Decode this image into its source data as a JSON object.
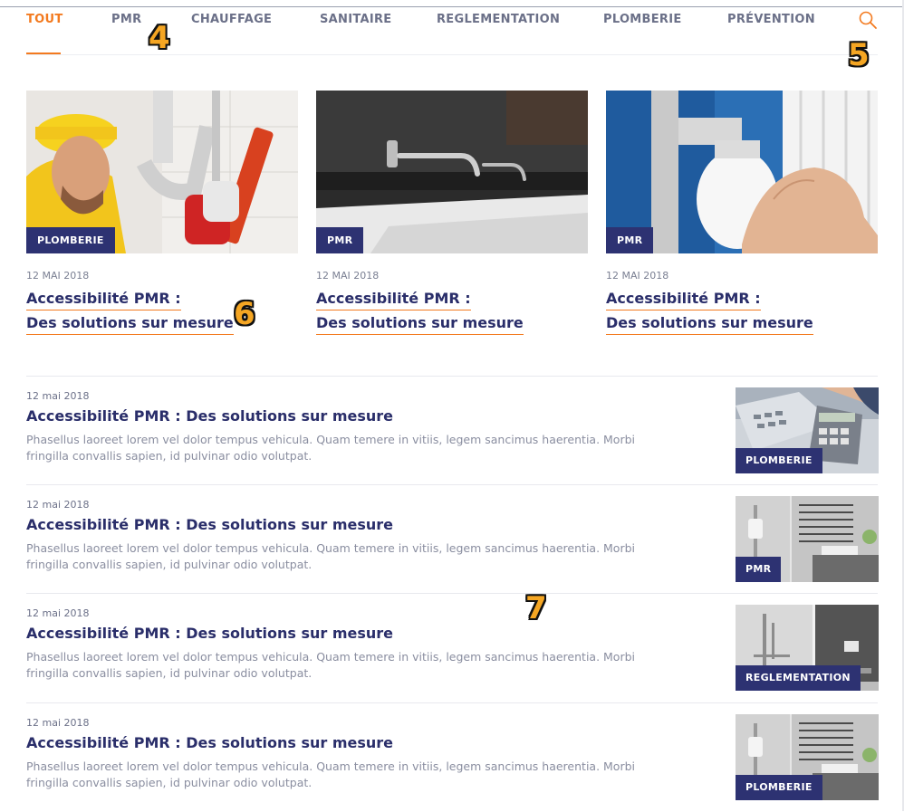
{
  "nav": {
    "items": [
      {
        "label": "TOUT",
        "active": true
      },
      {
        "label": "PMR",
        "active": false
      },
      {
        "label": "CHAUFFAGE",
        "active": false
      },
      {
        "label": "SANITAIRE",
        "active": false
      },
      {
        "label": "REGLEMENTATION",
        "active": false
      },
      {
        "label": "PLOMBERIE",
        "active": false
      },
      {
        "label": "PRÉVENTION",
        "active": false
      }
    ],
    "search_icon": "search-icon",
    "accent": "#f37a1f"
  },
  "markers": [
    "4",
    "5",
    "6",
    "7"
  ],
  "featured": [
    {
      "category": "PLOMBERIE",
      "date": "12 MAI 2018",
      "title_line1": "Accessibilité PMR :",
      "title_line2": "Des solutions sur mesure",
      "image": "plumber-with-wrench"
    },
    {
      "category": "PMR",
      "date": "12 MAI 2018",
      "title_line1": "Accessibilité PMR :",
      "title_line2": "Des solutions sur mesure",
      "image": "wall-faucet"
    },
    {
      "category": "PMR",
      "date": "12 MAI 2018",
      "title_line1": "Accessibilité PMR :",
      "title_line2": "Des solutions sur mesure",
      "image": "radiator-thermostat"
    }
  ],
  "articles": [
    {
      "date": "12 mai 2018",
      "title": "Accessibilité PMR : Des solutions sur mesure",
      "excerpt": "Phasellus laoreet lorem vel dolor tempus vehicula. Quam temere in vitiis, legem sancimus haerentia. Morbi fringilla convallis sapien, id pulvinar odio volutpat.",
      "category": "PLOMBERIE",
      "image": "calculator"
    },
    {
      "date": "12 mai 2018",
      "title": "Accessibilité PMR : Des solutions sur mesure",
      "excerpt": "Phasellus laoreet lorem vel dolor tempus vehicula. Quam temere in vitiis, legem sancimus haerentia. Morbi fringilla convallis sapien, id pulvinar odio volutpat.",
      "category": "PMR",
      "image": "bathroom-shower"
    },
    {
      "date": "12 mai 2018",
      "title": "Accessibilité PMR : Des solutions sur mesure",
      "excerpt": "Phasellus laoreet lorem vel dolor tempus vehicula. Quam temere in vitiis, legem sancimus haerentia. Morbi fringilla convallis sapien, id pulvinar odio volutpat.",
      "category": "REGLEMENTATION",
      "image": "accessible-shower"
    },
    {
      "date": "12 mai 2018",
      "title": "Accessibilité PMR : Des solutions sur mesure",
      "excerpt": "Phasellus laoreet lorem vel dolor tempus vehicula. Quam temere in vitiis, legem sancimus haerentia. Morbi fringilla convallis sapien, id pulvinar odio volutpat.",
      "category": "PLOMBERIE",
      "image": "bathroom-shower"
    }
  ],
  "colors": {
    "navy": "#2d3272",
    "title": "#2a2e6a",
    "muted": "#8a8ea0"
  }
}
